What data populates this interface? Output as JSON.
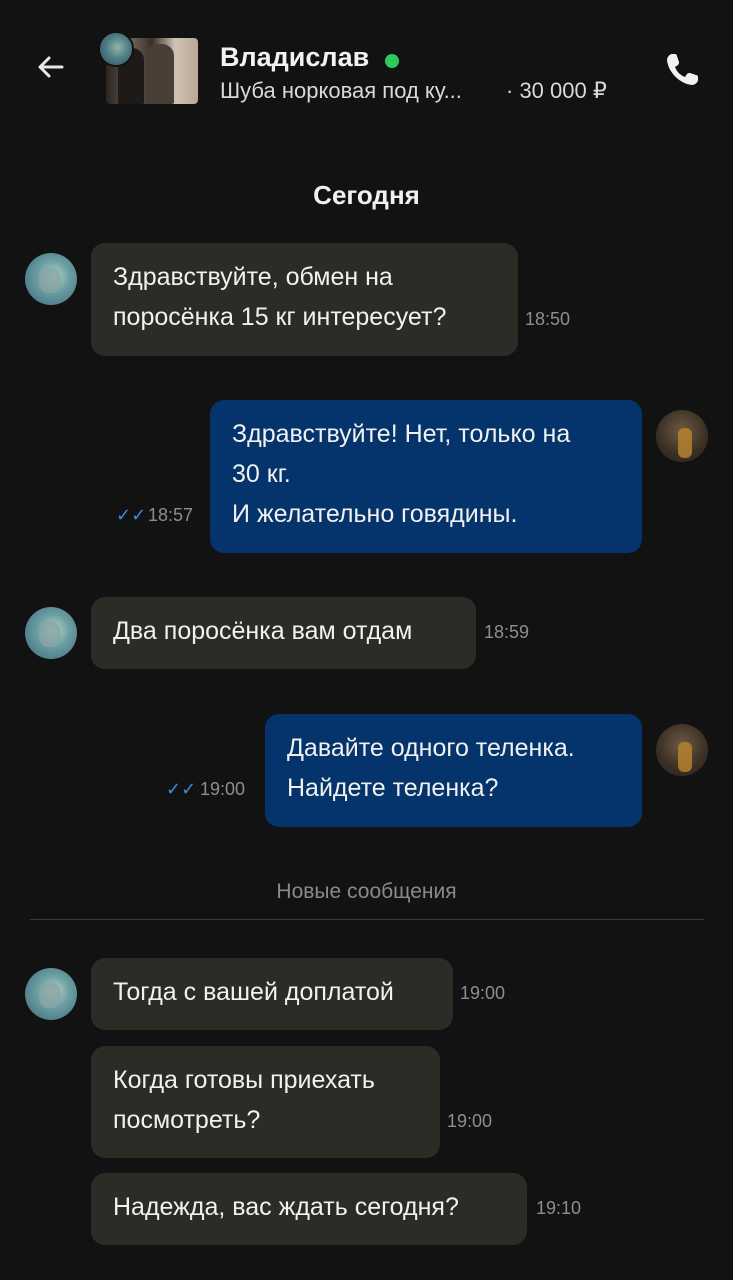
{
  "header": {
    "back_icon": "arrow-left-icon",
    "seller_name": "Владислав",
    "online_color": "#2fc95b",
    "item_title": "Шуба норковая под ку...",
    "item_price": "· 30 000 ₽",
    "call_icon": "phone-icon"
  },
  "date_separator": "Сегодня",
  "new_messages_label": "Новые сообщения",
  "colors": {
    "background": "#121212",
    "incoming_bubble": "#2d2b26",
    "outgoing_bubble": "#05336b",
    "read_ticks": "#3b8ddc"
  },
  "messages": [
    {
      "direction": "in",
      "text": "Здравствуйте, обмен на\nпоросёнка 15 кг интересует?",
      "time": "18:50"
    },
    {
      "direction": "out",
      "text": "Здравствуйте! Нет, только на\n30 кг.\nИ желательно говядины.",
      "time": "18:57",
      "ticks": "✓✓"
    },
    {
      "direction": "in",
      "text": "Два поросёнка вам отдам",
      "time": "18:59"
    },
    {
      "direction": "out",
      "text": "Давайте одного теленка.\nНайдете теленка?",
      "time": "19:00",
      "ticks": "✓✓"
    },
    {
      "direction": "in",
      "text": "Тогда с вашей доплатой",
      "time": "19:00"
    },
    {
      "direction": "in",
      "text": "Когда готовы приехать\nпосмотреть?",
      "time": "19:00"
    },
    {
      "direction": "in",
      "text": "Надежда, вас ждать сегодня?",
      "time": "19:10"
    }
  ]
}
